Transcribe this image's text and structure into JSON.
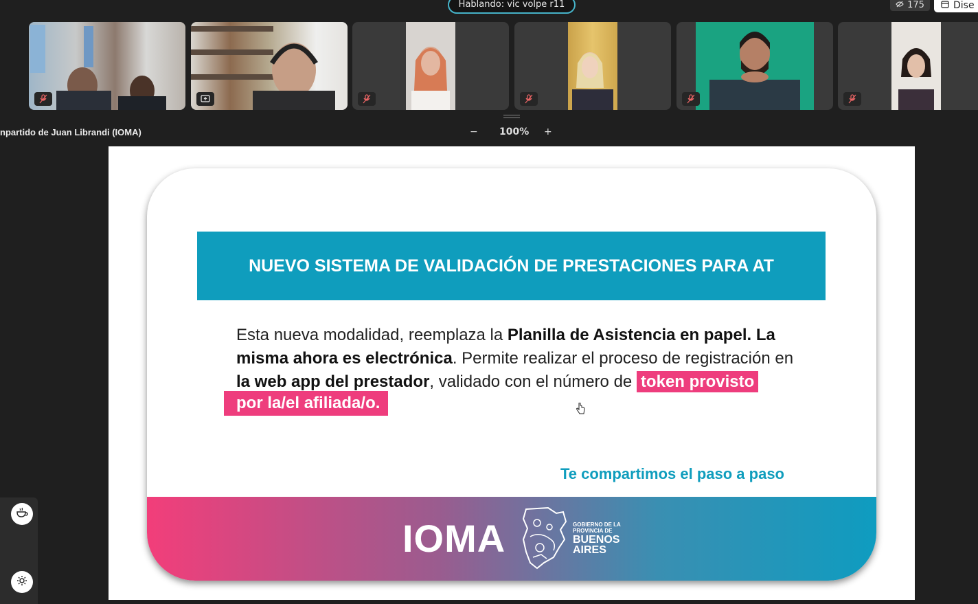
{
  "top_bar": {
    "speaking_label": "Hablando: vic volpe r11",
    "participant_count": "175",
    "design_label": "Dise"
  },
  "participants": [
    {
      "name": "tile-1",
      "mic": "muted"
    },
    {
      "name": "tile-2",
      "mic": "share"
    },
    {
      "name": "tile-3",
      "mic": "muted"
    },
    {
      "name": "tile-4",
      "mic": "muted"
    },
    {
      "name": "tile-5",
      "mic": "muted"
    },
    {
      "name": "tile-6",
      "mic": "muted"
    }
  ],
  "share": {
    "label": "npartido de Juan Librandi (IOMA)",
    "zoom_minus": "−",
    "zoom_level": "100%",
    "zoom_plus": "+"
  },
  "slide": {
    "title": "NUEVO SISTEMA DE VALIDACIÓN DE PRESTACIONES PARA AT",
    "p1": "Esta nueva modalidad, reemplaza la ",
    "b1": "Planilla de Asistencia en papel. La misma ahora es electrónica",
    "p2": ". Permite realizar el proceso de registración en ",
    "b2": "la web app del prestador",
    "p3": ", validado con el número de",
    "hl1": "token provisto",
    "hl2": "por la/el afiliada/o.",
    "step": "Te compartimos el paso a paso",
    "logo": "IOMA",
    "gov_small_1": "GOBIERNO DE LA",
    "gov_small_2": "PROVINCIA DE",
    "gov_big_1": "BUENOS",
    "gov_big_2": "AIRES"
  },
  "colors": {
    "accent_teal": "#0f9dbd",
    "accent_pink": "#ee3d7d"
  }
}
